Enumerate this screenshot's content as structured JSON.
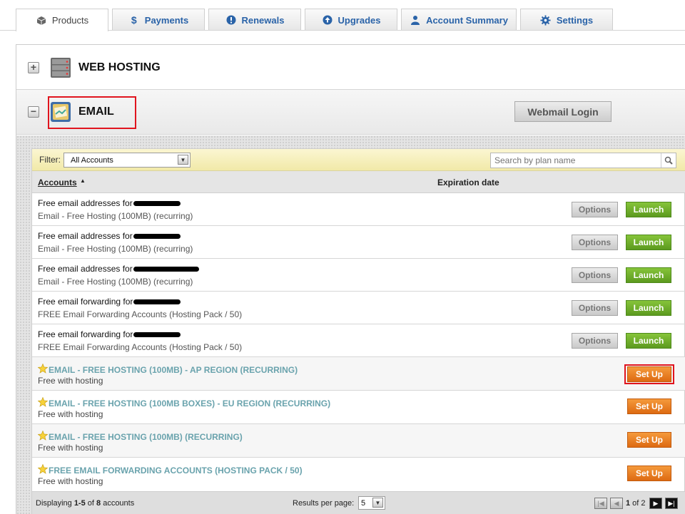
{
  "tabs": [
    {
      "label": "Products",
      "icon": "cube-icon"
    },
    {
      "label": "Payments",
      "icon": "dollar-icon"
    },
    {
      "label": "Renewals",
      "icon": "alert-icon"
    },
    {
      "label": "Upgrades",
      "icon": "upload-icon"
    },
    {
      "label": "Account Summary",
      "icon": "user-icon"
    },
    {
      "label": "Settings",
      "icon": "gear-icon"
    }
  ],
  "sections": {
    "web_hosting": {
      "title": "WEB HOSTING",
      "toggle": "+"
    },
    "email": {
      "title": "EMAIL",
      "toggle": "−",
      "webmail_label": "Webmail Login"
    }
  },
  "filter": {
    "label": "Filter:",
    "selected": "All Accounts",
    "search_placeholder": "Search by plan name"
  },
  "table": {
    "col_accounts": "Accounts",
    "col_expiration": "Expiration date",
    "rows": [
      {
        "title": "Free email addresses for",
        "plan": "Email - Free Hosting (100MB) (recurring)",
        "options": "Options",
        "launch": "Launch"
      },
      {
        "title": "Free email addresses for",
        "plan": "Email - Free Hosting (100MB) (recurring)",
        "options": "Options",
        "launch": "Launch"
      },
      {
        "title": "Free email addresses for",
        "plan": "Email - Free Hosting (100MB) (recurring)",
        "options": "Options",
        "launch": "Launch"
      },
      {
        "title": "Free email forwarding for",
        "plan": "FREE Email Forwarding Accounts (Hosting Pack / 50)",
        "options": "Options",
        "launch": "Launch"
      },
      {
        "title": "Free email forwarding for",
        "plan": "FREE Email Forwarding Accounts (Hosting Pack / 50)",
        "options": "Options",
        "launch": "Launch"
      }
    ],
    "setup_rows": [
      {
        "title": "EMAIL - FREE HOSTING (100MB) - AP REGION (RECURRING)",
        "sub": "Free with hosting",
        "button": "Set Up"
      },
      {
        "title": "EMAIL - FREE HOSTING (100MB BOXES) - EU REGION (RECURRING)",
        "sub": "Free with hosting",
        "button": "Set Up"
      },
      {
        "title": "EMAIL - FREE HOSTING (100MB) (RECURRING)",
        "sub": "Free with hosting",
        "button": "Set Up"
      },
      {
        "title": "FREE EMAIL FORWARDING ACCOUNTS (HOSTING PACK / 50)",
        "sub": "Free with hosting",
        "button": "Set Up"
      }
    ]
  },
  "footer": {
    "displaying_prefix": "Displaying ",
    "range": "1-5",
    "of": " of ",
    "total": "8",
    "suffix": " accounts",
    "rpp_label": "Results per page:",
    "rpp_value": "5",
    "page_current": "1",
    "page_of": " of ",
    "page_total": "2"
  },
  "colors": {
    "accent_blue": "#2a63a8",
    "launch_green": "#6aab2a",
    "setup_orange": "#e8761c",
    "highlight_red": "#e0141e",
    "setup_title_teal": "#6aa3ad"
  }
}
